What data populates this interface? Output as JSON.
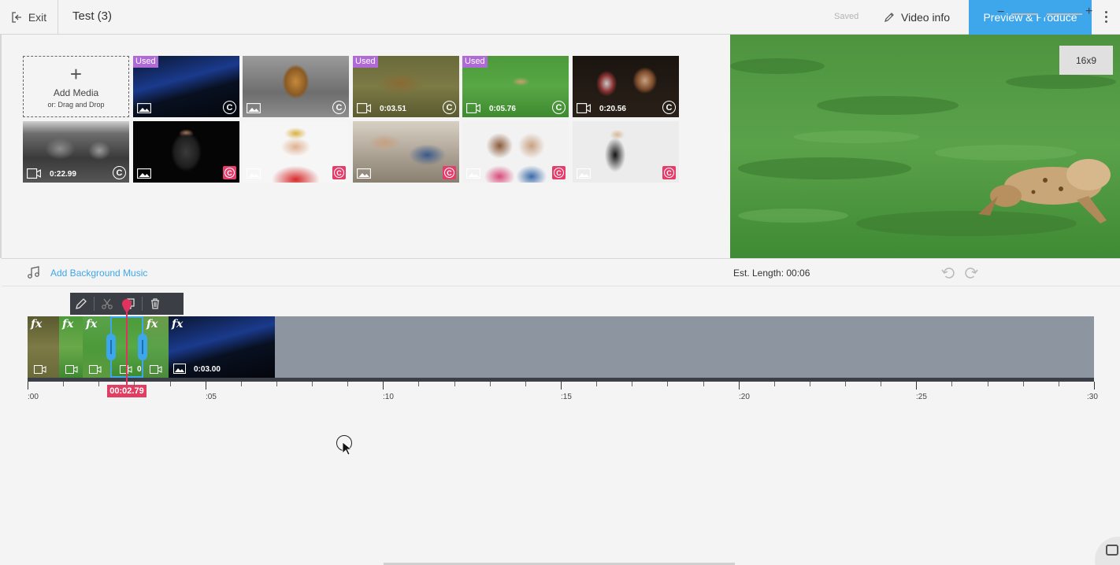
{
  "header": {
    "exit_label": "Exit",
    "title": "Test (3)",
    "saved_label": "Saved",
    "video_info_label": "Video info",
    "produce_label": "Preview & Produce",
    "accent": "#3ea7eb"
  },
  "library": {
    "add_media_label": "Add Media",
    "add_media_hint": "or: Drag and Drop",
    "used_badge": "Used",
    "tiles": [
      {
        "kind": "image",
        "used": true,
        "duration": "",
        "license": "standard"
      },
      {
        "kind": "image",
        "used": false,
        "duration": "",
        "license": "standard"
      },
      {
        "kind": "video",
        "used": true,
        "duration": "0:03.51",
        "license": "standard"
      },
      {
        "kind": "video",
        "used": true,
        "duration": "0:05.76",
        "license": "standard"
      },
      {
        "kind": "video",
        "used": false,
        "duration": "0:20.56",
        "license": "standard"
      },
      {
        "kind": "video",
        "used": false,
        "duration": "0:22.99",
        "license": "standard"
      },
      {
        "kind": "image",
        "used": false,
        "duration": "",
        "license": "premium"
      },
      {
        "kind": "image",
        "used": false,
        "duration": "",
        "license": "premium"
      },
      {
        "kind": "image",
        "used": false,
        "duration": "",
        "license": "premium"
      },
      {
        "kind": "image",
        "used": false,
        "duration": "",
        "license": "premium"
      },
      {
        "kind": "image",
        "used": false,
        "duration": "",
        "license": "premium"
      }
    ],
    "license_glyph": "C",
    "used_color": "#b06ad8",
    "premium_color": "#e43c6b"
  },
  "preview": {
    "aspect_label": "16x9"
  },
  "music": {
    "add_label": "Add Background Music",
    "est_length_label": "Est. Length: 00:06",
    "zoom_level": 0.44
  },
  "timeline": {
    "playhead_time": "00:02.79",
    "fx_label": "fx",
    "last_clip_duration": "0:03.00",
    "partial_duration": "0",
    "ruler_labels": [
      ":00",
      ":05",
      ":10",
      ":15",
      ":20",
      ":25",
      ":30"
    ],
    "toolbar": [
      "edit",
      "cut",
      "duplicate",
      "delete"
    ]
  }
}
